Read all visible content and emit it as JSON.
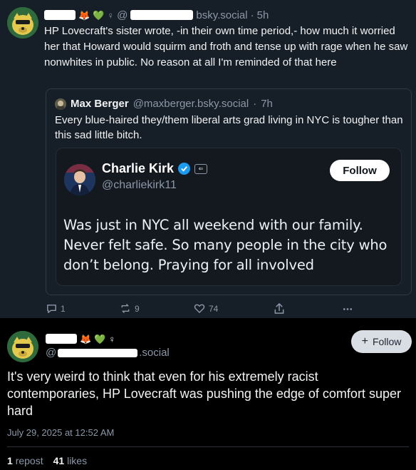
{
  "top_post": {
    "handle_suffix": "bsky.social",
    "time": "5h",
    "text": "HP Lovecraft's sister wrote, -in their own time period,- how much it worried her that Howard would squirm and froth and tense up with rage when he saw nonwhites in public. No reason at all I'm reminded of that here",
    "quote": {
      "name": "Max Berger",
      "handle": "@maxberger.bsky.social",
      "time": "7h",
      "text": "Every blue-haired they/them liberal arts grad living in NYC is tougher than this sad little bitch.",
      "embed": {
        "name": "Charlie Kirk",
        "handle": "@charliekirk11",
        "follow_label": "Follow",
        "text": "Was just in NYC all weekend with our family. Never felt safe. So many people in the city who don’t belong. Praying for all involved"
      }
    },
    "actions": {
      "replies": "1",
      "reposts": "9",
      "likes": "74"
    }
  },
  "main_post": {
    "handle_suffix": ".social",
    "follow_label": "Follow",
    "text": "It's very weird to think that even for his extremely racist contemporaries, HP Lovecraft was pushing the edge of comfort super hard",
    "date": "July 29, 2025 at 12:52 AM",
    "repost_count": "1",
    "repost_label": "repost",
    "like_count": "41",
    "like_label": "likes"
  },
  "icons": [
    "reply-icon",
    "repost-icon",
    "like-icon",
    "share-icon",
    "more-icon",
    "verified-icon",
    "plus-icon"
  ],
  "colors": {
    "background_top": "#161e27",
    "background_main": "#000000",
    "muted_text": "#8b98a8",
    "verified_blue": "#1d9bf0",
    "avatar_green": "#2f6b3d"
  }
}
